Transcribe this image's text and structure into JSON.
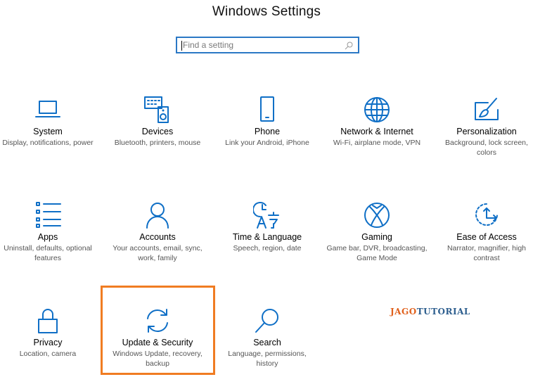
{
  "window": {
    "title": "Windows Settings"
  },
  "search": {
    "placeholder": "Find a setting",
    "icon": "search-icon"
  },
  "tiles": [
    {
      "name": "System",
      "desc": "Display, notifications, power",
      "icon": "laptop-icon"
    },
    {
      "name": "Devices",
      "desc": "Bluetooth, printers, mouse",
      "icon": "keyboard-speaker-icon"
    },
    {
      "name": "Phone",
      "desc": "Link your Android, iPhone",
      "icon": "phone-icon"
    },
    {
      "name": "Network & Internet",
      "desc": "Wi-Fi, airplane mode, VPN",
      "icon": "globe-icon"
    },
    {
      "name": "Personalization",
      "desc": "Background, lock screen, colors",
      "icon": "paint-brush-icon"
    },
    {
      "name": "Apps",
      "desc": "Uninstall, defaults, optional features",
      "icon": "apps-list-icon"
    },
    {
      "name": "Accounts",
      "desc": "Your accounts, email, sync, work, family",
      "icon": "person-icon"
    },
    {
      "name": "Time & Language",
      "desc": "Speech, region, date",
      "icon": "clock-language-icon"
    },
    {
      "name": "Gaming",
      "desc": "Game bar, DVR, broadcasting, Game Mode",
      "icon": "xbox-icon"
    },
    {
      "name": "Ease of Access",
      "desc": "Narrator, magnifier, high contrast",
      "icon": "ease-of-access-icon"
    },
    {
      "name": "Privacy",
      "desc": "Location, camera",
      "icon": "lock-icon"
    },
    {
      "name": "Update & Security",
      "desc": "Windows Update, recovery, backup",
      "icon": "sync-icon"
    },
    {
      "name": "Search",
      "desc": "Language, permissions, history",
      "icon": "magnifier-icon"
    }
  ],
  "watermark": {
    "part1": "JAGO",
    "part2": "TUTORIAL"
  },
  "colors": {
    "accent": "#0f6fc6",
    "highlight": "#f07c22",
    "search_border": "#2b78c5"
  }
}
